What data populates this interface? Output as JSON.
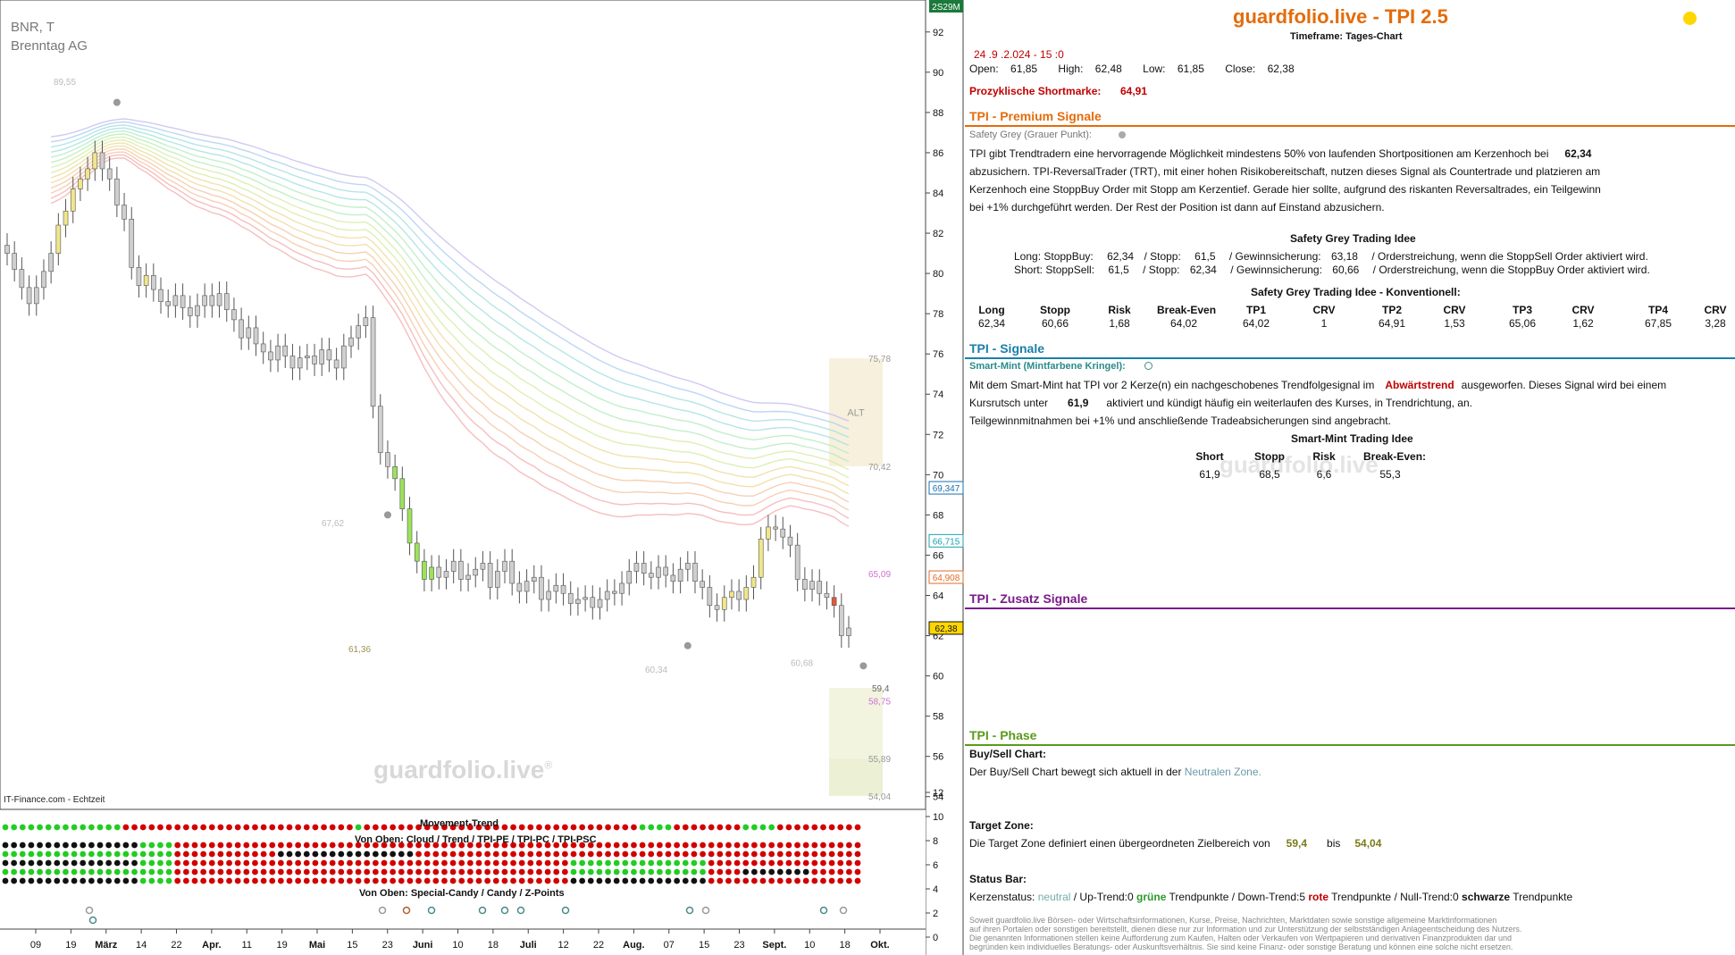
{
  "chart_data": {
    "type": "candlestick",
    "symbol": "BNR, T",
    "name": "Brenntag AG",
    "source_label": "IT-Finance.com - Echtzeit",
    "watermark": "guardfolio.live",
    "watermark_reg": "®",
    "ylim": [
      53.5,
      93.5
    ],
    "y_ticks": [
      92,
      90,
      88,
      86,
      84,
      82,
      80,
      78,
      76,
      74,
      72,
      70,
      68,
      66,
      64,
      62,
      60,
      58,
      56,
      54
    ],
    "x_ticks": [
      "09",
      "19",
      "März",
      "14",
      "22",
      "Apr.",
      "11",
      "19",
      "Mai",
      "15",
      "23",
      "Juni",
      "10",
      "18",
      "Juli",
      "12",
      "22",
      "Aug.",
      "07",
      "15",
      "23",
      "Sept.",
      "10",
      "18",
      "Okt."
    ],
    "top_tag": "2S29M",
    "price_tags": [
      {
        "text": "69,347",
        "value": 69.347,
        "color": "#1a6fb0"
      },
      {
        "text": "66,715",
        "value": 66.715,
        "color": "#1aa3b0"
      },
      {
        "text": "64,908",
        "value": 64.908,
        "color": "#e06c2a"
      },
      {
        "text": "62,38",
        "value": 62.38,
        "color": "#111111"
      }
    ],
    "level_labels": [
      {
        "text": "89,55",
        "value": 89.55,
        "color": "#bbbbbb"
      },
      {
        "text": "67,62",
        "value": 67.62,
        "color": "#bbbbbb"
      },
      {
        "text": "61,36",
        "value": 61.36,
        "color": "#a09050"
      },
      {
        "text": "60,34",
        "value": 60.34,
        "color": "#bbbbbb"
      },
      {
        "text": "60,68",
        "value": 60.68,
        "color": "#bbbbbb"
      },
      {
        "text": "75,78",
        "value": 75.78,
        "color": "#999999"
      },
      {
        "text": "70,42",
        "value": 70.42,
        "color": "#999999"
      },
      {
        "text": "65,09",
        "value": 65.09,
        "color": "#d070d0"
      },
      {
        "text": "59,4",
        "value": 59.4,
        "color": "#666666"
      },
      {
        "text": "58,75",
        "value": 58.75,
        "color": "#d070d0"
      },
      {
        "text": "55,89",
        "value": 55.89,
        "color": "#999999"
      },
      {
        "text": "54,04",
        "value": 54.04,
        "color": "#999999"
      }
    ],
    "alt_zone": {
      "label": "ALT",
      "from": 70.42,
      "to": 75.78
    },
    "target_zone": {
      "from": 59.4,
      "to": 54.04,
      "mid": 55.89
    },
    "closes": [
      81.0,
      80.2,
      79.3,
      78.5,
      79.3,
      80.1,
      81.0,
      82.4,
      83.1,
      84.2,
      84.7,
      85.2,
      86.0,
      85.2,
      84.7,
      83.4,
      82.7,
      80.3,
      79.4,
      79.9,
      79.2,
      78.6,
      78.4,
      78.9,
      78.3,
      77.9,
      78.4,
      78.9,
      78.4,
      79.0,
      78.2,
      77.7,
      76.8,
      77.3,
      76.5,
      76.1,
      75.7,
      76.4,
      75.9,
      75.3,
      75.8,
      75.9,
      75.5,
      76.2,
      75.7,
      75.3,
      76.4,
      76.8,
      77.4,
      77.8,
      73.4,
      71.1,
      70.4,
      69.8,
      68.3,
      66.6,
      65.7,
      64.8,
      65.4,
      64.9,
      65.2,
      65.7,
      64.8,
      65.0,
      65.3,
      65.6,
      64.4,
      65.2,
      65.7,
      64.6,
      64.2,
      64.7,
      64.9,
      63.8,
      64.2,
      64.5,
      64.1,
      63.6,
      63.8,
      63.9,
      63.4,
      63.8,
      64.2,
      64.1,
      64.6,
      65.2,
      65.6,
      65.1,
      64.9,
      65.4,
      65.0,
      64.7,
      65.3,
      65.6,
      64.7,
      64.4,
      63.5,
      63.3,
      63.9,
      64.2,
      63.8,
      64.4,
      64.9,
      66.8,
      67.4,
      67.3,
      66.9,
      66.5,
      64.8,
      64.3,
      64.7,
      64.1,
      63.9,
      63.5,
      62.0,
      62.38
    ],
    "movement_trend_title": "Movement-Trend",
    "movement_trend_sub": "Von Oben: Cloud / Trend / TPI-PE / TPI-PC / TPI-PSC",
    "candy_title": "Von Oben: Special-Candy / Candy / Z-Points",
    "indicator_ticks": [
      "12",
      "10",
      "8",
      "6",
      "4",
      "2",
      "0"
    ]
  },
  "panel": {
    "brand": "guardfolio.live - TPI 2.5",
    "timeframe": "Timeframe: Tages-Chart",
    "status_dot_color": "#ffd700",
    "datetime": "24 .9 .2.024  - 15 :0",
    "ohlc": {
      "open_label": "Open:",
      "open": "61,85",
      "high_label": "High:",
      "high": "62,48",
      "low_label": "Low:",
      "low": "61,85",
      "close_label": "Close:",
      "close": "62,38"
    },
    "shortmarke_label": "Prozyklische Shortmarke:",
    "shortmarke_value": "64,91",
    "premium": {
      "title": "TPI - Premium Signale",
      "color": "#e46c0a",
      "safety_label": "Safety Grey (Grauer Punkt):",
      "text_l1a": "TPI gibt Trendtradern eine hervorragende Möglichkeit mindestens 50% von laufenden Shortpositionen am Kerzenhoch bei",
      "text_l1b": "62,34",
      "text_l2": "abzusichern. TPI-ReversalTrader (TRT), mit einer hohen Risikobereitschaft, nutzen dieses Signal als Countertrade und platzieren am",
      "text_l3": "Kerzenhoch eine StoppBuy Order mit Stopp am Kerzentief. Gerade hier sollte, aufgrund des riskanten Reversaltrades, ein Teilgewinn",
      "text_l4": "bei +1% durchgeführt werden. Der Rest der Position ist dann auf Einstand abzusichern.",
      "idea_title": "Safety Grey Trading Idee",
      "long_row": {
        "a": "Long: StoppBuy:",
        "b": "62,34",
        "c": "/ Stopp:",
        "d": "61,5",
        "e": "/ Gewinnsicherung:",
        "f": "63,18",
        "g": "/ Orderstreichung, wenn die StoppSell Order aktiviert wird."
      },
      "short_row": {
        "a": "Short: StoppSell:",
        "b": "61,5",
        "c": "/ Stopp:",
        "d": "62,34",
        "e": "/ Gewinnsicherung:",
        "f": "60,66",
        "g": "/ Orderstreichung, wenn die StoppBuy Order aktiviert wird."
      },
      "conv_title": "Safety Grey Trading Idee - Konventionell:",
      "conv_headers": [
        "Long",
        "Stopp",
        "Risk",
        "Break-Even",
        "TP1",
        "CRV",
        "TP2",
        "CRV",
        "TP3",
        "CRV",
        "TP4",
        "CRV"
      ],
      "conv_values": [
        "62,34",
        "60,66",
        "1,68",
        "64,02",
        "64,02",
        "1",
        "64,91",
        "1,53",
        "65,06",
        "1,62",
        "67,85",
        "3,28"
      ]
    },
    "signale": {
      "title": "TPI - Signale",
      "color": "#1a7fa8",
      "mint_label": "Smart-Mint (Mintfarbene Kringel):",
      "l1a": "Mit dem Smart-Mint hat TPI vor 2  Kerze(n) ein nachgeschobenes Trendfolgesignal im",
      "l1b": "Abwärtstrend",
      "l1c": "ausgeworfen. Dieses Signal wird bei einem",
      "l2a": "Kursrutsch unter",
      "l2b": "61,9",
      "l2c": "aktiviert und kündigt häufig ein weiterlaufen des Kurses, in Trendrichtung, an.",
      "l3": "Teilgewinnmitnahmen bei +1% und anschließende Tradeabsicherungen sind angebracht.",
      "idea_title": "Smart-Mint Trading Idee",
      "headers": [
        "Short",
        "Stopp",
        "Risk",
        "Break-Even:"
      ],
      "values": [
        "61,9",
        "68,5",
        "6,6",
        "55,3"
      ],
      "watermark": "guardfolio.live"
    },
    "zusatz": {
      "title": "TPI - Zusatz Signale",
      "color": "#7a1a8a"
    },
    "phase": {
      "title": "TPI - Phase",
      "color": "#5a9a1a",
      "bs_label": "Buy/Sell Chart:",
      "bs_text_a": "Der Buy/Sell Chart bewegt sich aktuell in der",
      "bs_text_b": "Neutralen Zone.",
      "tz_label": "Target Zone:",
      "tz_text": "Die Target Zone definiert einen übergeordneten Zielbereich von",
      "tz_from": "59,4",
      "tz_bis": "bis",
      "tz_to": "54,04",
      "sb_label": "Status Bar:",
      "sb_1": "Kerzenstatus:",
      "sb_2": "neutral",
      "sb_3": "/ Up-Trend:0",
      "sb_4": "grüne",
      "sb_5": "Trendpunkte  / Down-Trend:5",
      "sb_6": "rote",
      "sb_7": "Trendpunkte  / Null-Trend:0",
      "sb_8": "schwarze",
      "sb_9": "Trendpunkte"
    },
    "disclaimer": [
      "Soweit guardfolio.live Börsen- oder Wirtschaftsinformationen, Kurse, Preise, Nachrichten, Marktdaten sowie sonstige allgemeine Marktinformationen",
      "auf ihren Portalen oder sonstigen bereitstellt, dienen diese nur zur Information und zur Unterstützung der selbstständigen Anlageentscheidung des Nutzers.",
      "Die genannten Informationen stellen keine Aufforderung zum Kaufen, Halten oder Verkaufen von Wertpapieren und derivativen Finanzprodukten dar und",
      "begründen kein individuelles Beratungs- oder Auskunftsverhältnis. Sie sind keine Finanz- oder sonstige Beratung und können eine solche nicht ersetzen."
    ]
  }
}
